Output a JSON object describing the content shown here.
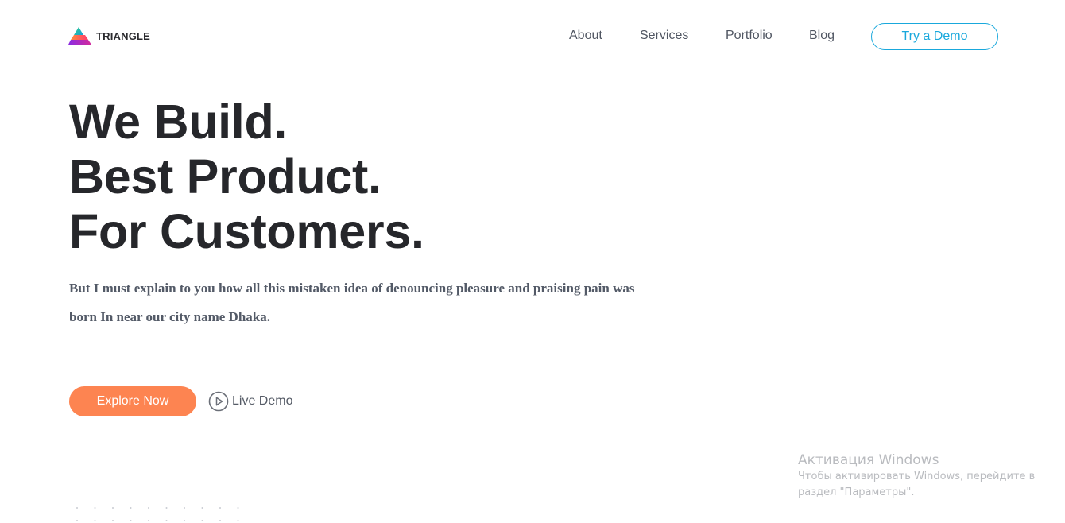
{
  "brand": {
    "name": "TRIANGLE"
  },
  "nav": {
    "items": [
      {
        "label": "About"
      },
      {
        "label": "Services"
      },
      {
        "label": "Portfolio"
      },
      {
        "label": "Blog"
      }
    ],
    "cta_label": "Try a Demo"
  },
  "hero": {
    "title_lines": [
      "We Build.",
      "Best Product.",
      "For Customers."
    ],
    "description": "But I must explain to you how all this mistaken idea of denouncing pleasure and praising pain was born In near our city name Dhaka.",
    "primary_button": "Explore Now",
    "secondary_link": "Live Demo"
  },
  "windows_activation": {
    "title": "Активация Windows",
    "line1": "Чтобы активировать Windows, перейдите в",
    "line2": "раздел \"Параметры\"."
  },
  "colors": {
    "accent_blue": "#19a8dc",
    "accent_orange": "#fd8451",
    "heading": "#26272b",
    "body_text": "#535a67",
    "nav_text": "#505662"
  },
  "icons": {
    "logo": "triangle-logo-icon",
    "play": "play-circle-icon"
  }
}
